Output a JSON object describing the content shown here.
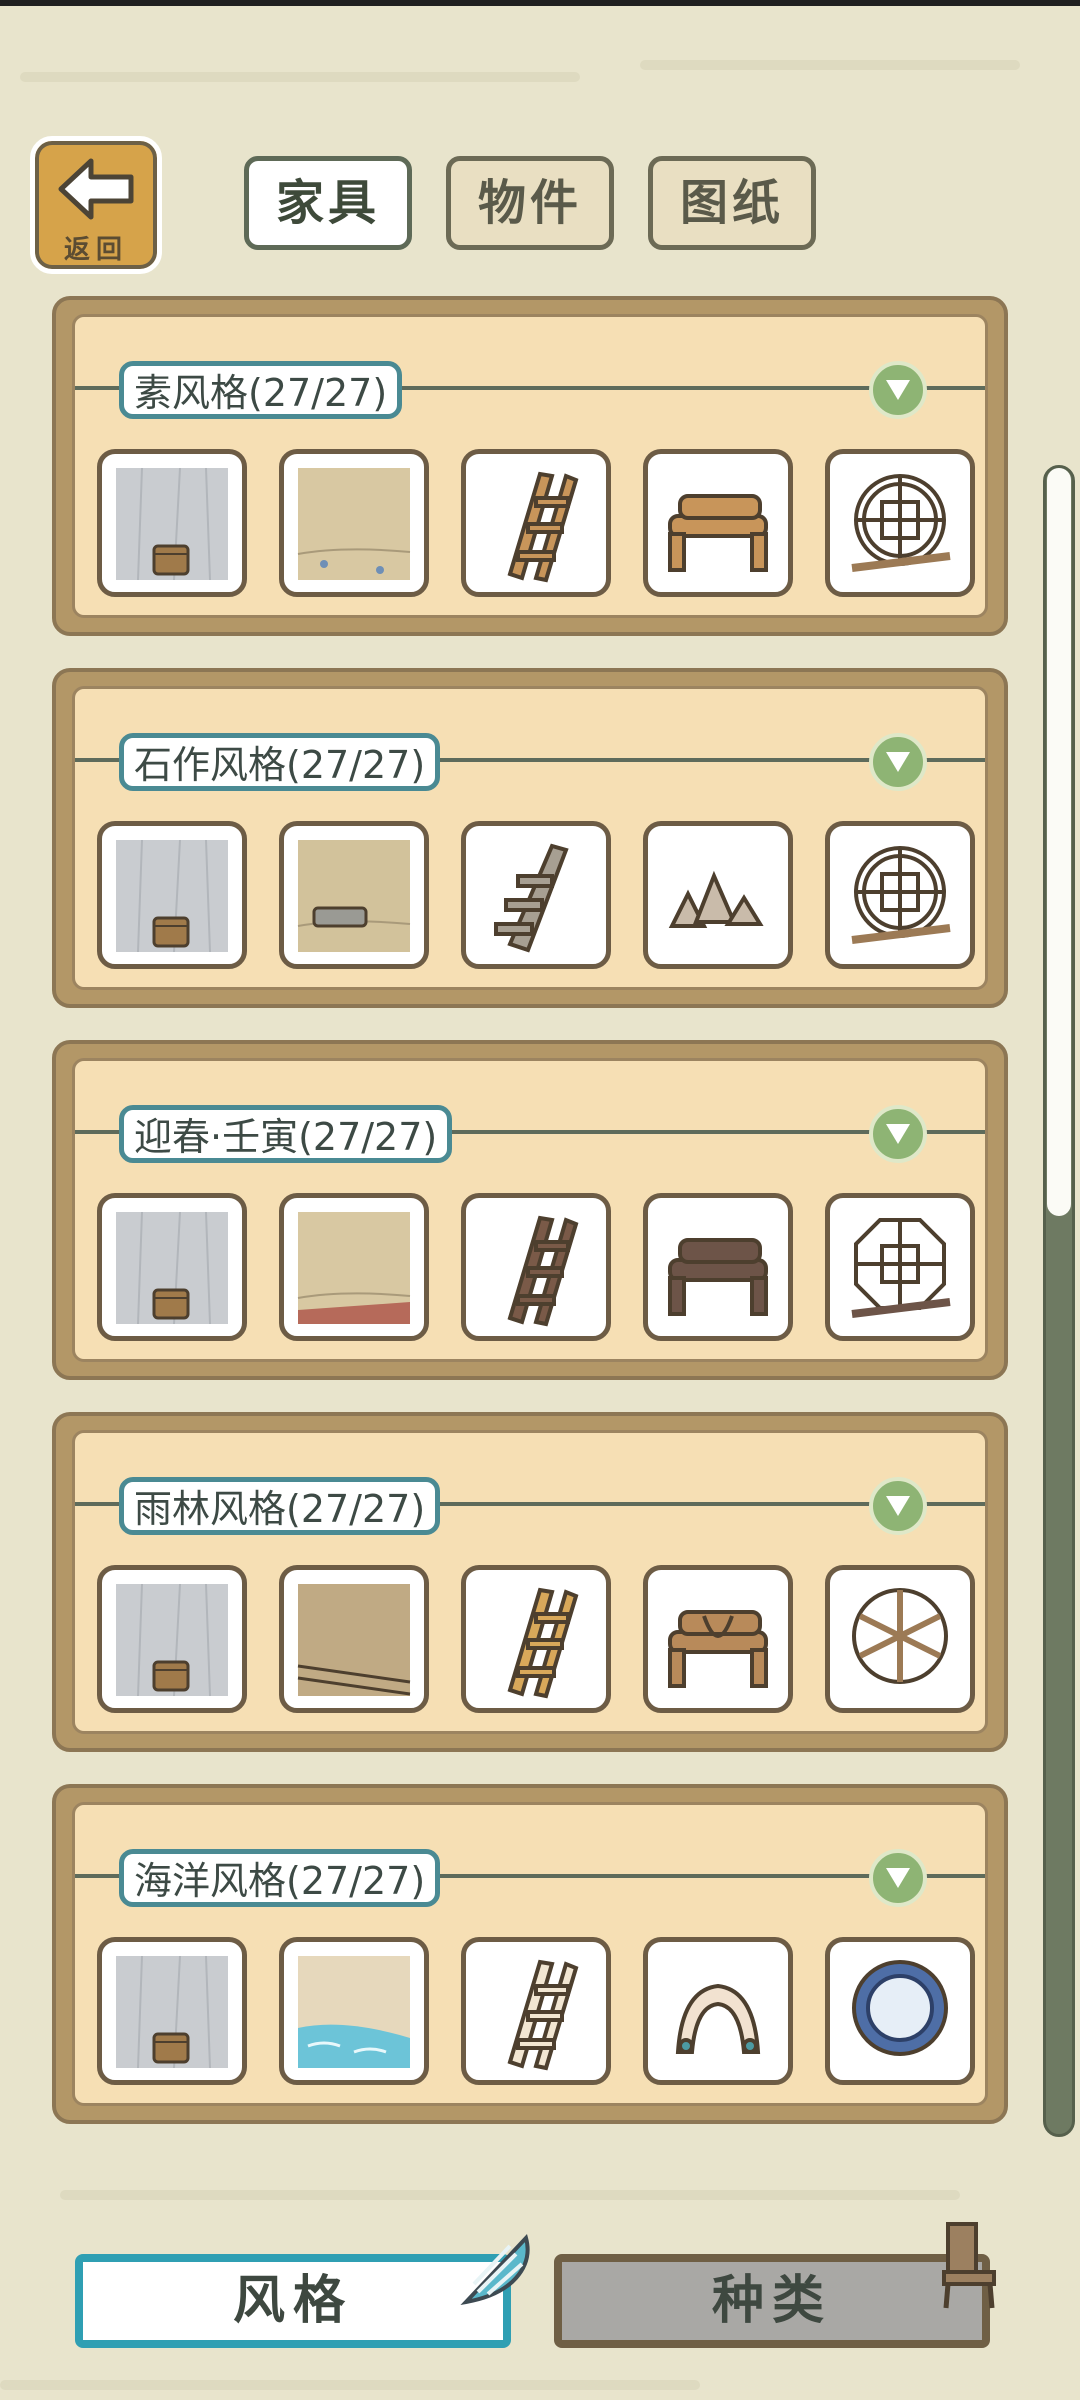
{
  "header": {
    "back_label": "返回",
    "tabs": [
      {
        "label": "家具",
        "active": true
      },
      {
        "label": "物件",
        "active": false
      },
      {
        "label": "图纸",
        "active": false
      }
    ]
  },
  "styles": [
    {
      "title": "素风格(27/27)",
      "items": [
        "wall-bucket",
        "floor-sand",
        "ladder",
        "log-bench",
        "round-window"
      ]
    },
    {
      "title": "石作风格(27/27)",
      "items": [
        "wall-bucket",
        "floor-stone",
        "stone-stairs",
        "rock-pile",
        "round-window"
      ]
    },
    {
      "title": "迎春·壬寅(27/27)",
      "items": [
        "wall-bucket",
        "floor-red",
        "dark-ladder",
        "dark-log-bench",
        "octagon-window"
      ]
    },
    {
      "title": "雨林风格(27/27)",
      "items": [
        "wall-bucket",
        "floor-wood",
        "bamboo-ladder",
        "rope-bench",
        "vine-window"
      ]
    },
    {
      "title": "海洋风格(27/27)",
      "items": [
        "wall-bucket",
        "floor-water",
        "bone-ladder",
        "coral-arch",
        "porthole-window"
      ]
    }
  ],
  "bottom": {
    "style_label": "风格",
    "type_label": "种类"
  },
  "colors": {
    "accent": "#2f9fb3",
    "card": "#b39767",
    "card_inner": "#f6dfb4",
    "toggle": "#8eb474"
  }
}
